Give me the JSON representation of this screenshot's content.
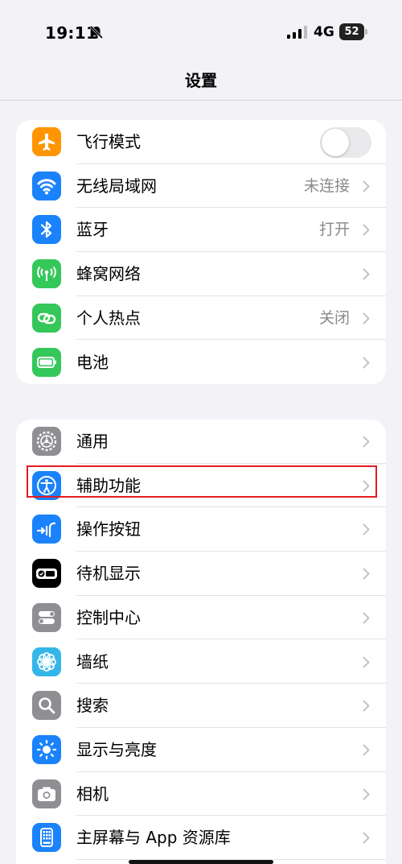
{
  "status_bar": {
    "time": "19:11",
    "network": "4G",
    "battery": "52"
  },
  "nav": {
    "title": "设置"
  },
  "group1": [
    {
      "label": "飞行模式",
      "value": "",
      "type": "toggle",
      "toggle_on": false,
      "icon": "airplane-icon",
      "color": "#ff9500"
    },
    {
      "label": "无线局域网",
      "value": "未连接",
      "type": "link",
      "icon": "wifi-icon",
      "color": "#1a82fb"
    },
    {
      "label": "蓝牙",
      "value": "打开",
      "type": "link",
      "icon": "bluetooth-icon",
      "color": "#1a82fb"
    },
    {
      "label": "蜂窝网络",
      "value": "",
      "type": "link",
      "icon": "cellular-icon",
      "color": "#34c759"
    },
    {
      "label": "个人热点",
      "value": "关闭",
      "type": "link",
      "icon": "hotspot-icon",
      "color": "#34c759"
    },
    {
      "label": "电池",
      "value": "",
      "type": "link",
      "icon": "battery-icon",
      "color": "#34c759"
    }
  ],
  "group2": [
    {
      "label": "通用",
      "icon": "gear-icon",
      "color": "#8e8e93"
    },
    {
      "label": "辅助功能",
      "icon": "accessibility-icon",
      "color": "#1a82fb",
      "highlighted": true
    },
    {
      "label": "操作按钮",
      "icon": "action-button-icon",
      "color": "#1a82fb"
    },
    {
      "label": "待机显示",
      "icon": "standby-icon",
      "color": "#000000"
    },
    {
      "label": "控制中心",
      "icon": "control-center-icon",
      "color": "#8e8e93"
    },
    {
      "label": "墙纸",
      "icon": "wallpaper-icon",
      "color": "#35b6e8"
    },
    {
      "label": "搜索",
      "icon": "search-icon",
      "color": "#8e8e93"
    },
    {
      "label": "显示与亮度",
      "icon": "brightness-icon",
      "color": "#1a82fb"
    },
    {
      "label": "相机",
      "icon": "camera-icon",
      "color": "#8e8e93"
    },
    {
      "label": "主屏幕与 App 资源库",
      "icon": "home-screen-icon",
      "color": "#1a82fb"
    }
  ]
}
